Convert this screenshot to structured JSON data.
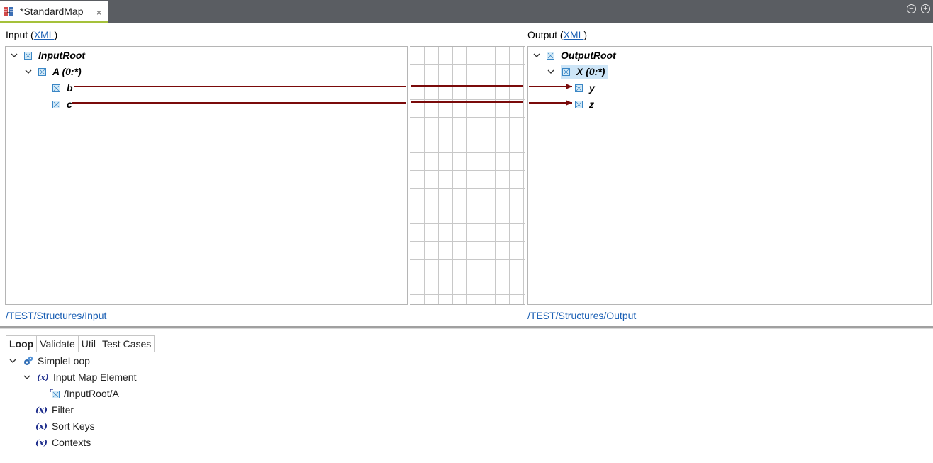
{
  "editor": {
    "tab_title": "*StandardMap",
    "tab_close": "×",
    "minimize": "−",
    "maximize": "+"
  },
  "input": {
    "label": "Input (",
    "link": "XML",
    "label_end": ")",
    "path": "/TEST/Structures/Input",
    "tree": [
      {
        "label": "InputRoot"
      },
      {
        "label": "A (0:*)"
      },
      {
        "label": "b"
      },
      {
        "label": "c"
      }
    ]
  },
  "output": {
    "label": "Output (",
    "link": "XML",
    "label_end": ")",
    "path": "/TEST/Structures/Output",
    "tree": [
      {
        "label": "OutputRoot"
      },
      {
        "label": "X (0:*)"
      },
      {
        "label": "y"
      },
      {
        "label": "z"
      }
    ]
  },
  "mappings": [
    {
      "from": "b",
      "to": "y"
    },
    {
      "from": "c",
      "to": "z"
    }
  ],
  "bottom": {
    "tabs": [
      "Loop",
      "Validate",
      "Util",
      "Test Cases"
    ],
    "active_tab": "Loop",
    "tree": [
      {
        "label": "SimpleLoop",
        "icon": "gear-icon"
      },
      {
        "label": "Input Map Element",
        "icon": "variable-icon"
      },
      {
        "label": "/InputRoot/A",
        "icon": "element-ref-icon"
      },
      {
        "label": "Filter",
        "icon": "variable-icon"
      },
      {
        "label": "Sort Keys",
        "icon": "variable-icon"
      },
      {
        "label": "Contexts",
        "icon": "variable-icon"
      }
    ],
    "variable_glyph": "(x)"
  },
  "colors": {
    "mapping_line": "#7a0a0a",
    "accent_underline": "#a5c13a",
    "link": "#1a5fb4",
    "selection": "#cde5f7"
  }
}
